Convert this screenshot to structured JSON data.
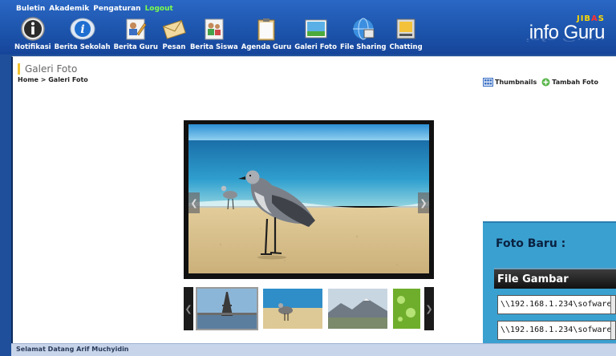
{
  "topmenu": {
    "items": [
      "Buletin",
      "Akademik",
      "Pengaturan"
    ],
    "logout": "Logout"
  },
  "toolbar": [
    {
      "label": "Notifikasi",
      "icon": "info-icon"
    },
    {
      "label": "Berita Sekolah",
      "icon": "info-globe-icon"
    },
    {
      "label": "Berita Guru",
      "icon": "teacher-news-icon"
    },
    {
      "label": "Pesan",
      "icon": "envelope-icon"
    },
    {
      "label": "Berita Siswa",
      "icon": "student-news-icon"
    },
    {
      "label": "Agenda Guru",
      "icon": "clipboard-icon"
    },
    {
      "label": "Galeri Foto",
      "icon": "photo-icon"
    },
    {
      "label": "File Sharing",
      "icon": "file-sharing-icon"
    },
    {
      "label": "Chatting",
      "icon": "chat-icon"
    }
  ],
  "brand": {
    "jibas_pre": "JIB",
    "jibas_a": "A",
    "jibas_post": "S",
    "name": "info Guru"
  },
  "page": {
    "title": "Galeri Foto",
    "breadcrumb": "Home > Galeri Foto"
  },
  "actions": {
    "thumbnails": "Thumbnails",
    "add_photo": "Tambah Foto"
  },
  "gallery": {
    "thumbnails": [
      "eiffel-tower",
      "seagull-beach",
      "mountains",
      "green-leaf"
    ]
  },
  "upload_panel": {
    "title": "Foto Baru :",
    "header": "File Gambar",
    "file1": "\\\\192.168.1.234\\sofware",
    "file2": "\\\\192.168.1.234\\sofware"
  },
  "footer": {
    "welcome": "Selamat Datang Arif Muchyidin"
  },
  "colors": {
    "header_blue": "#1d55ad",
    "logout_green": "#7cff4a",
    "panel_blue": "#3aa0cf"
  }
}
